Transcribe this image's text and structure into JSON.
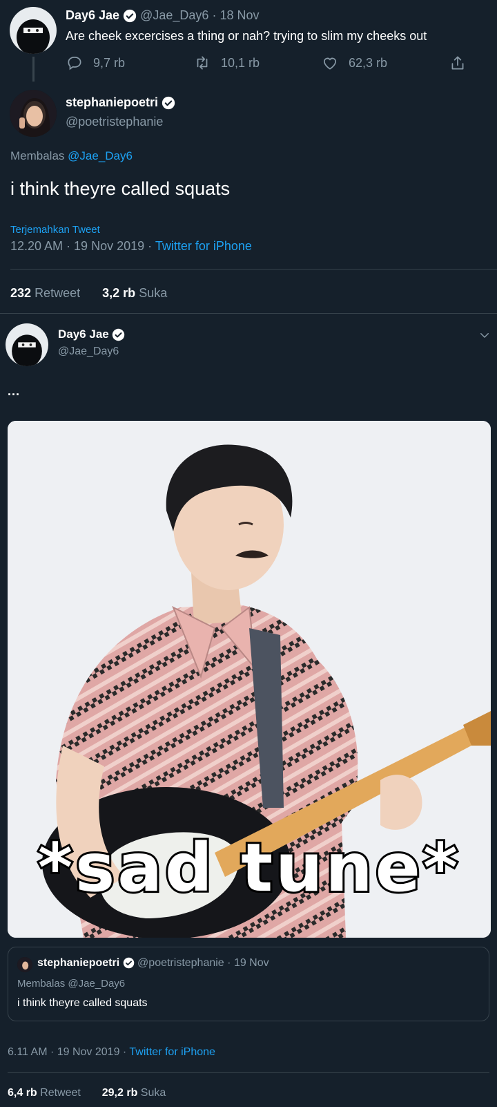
{
  "tweet1": {
    "name": "Day6 Jae",
    "handle": "@Jae_Day6",
    "sep": "·",
    "date": "18 Nov",
    "text": "Are cheek excercises a thing or nah? trying to slim my cheeks out",
    "replies": "9,7 rb",
    "retweets": "10,1 rb",
    "likes": "62,3 rb"
  },
  "reply": {
    "name": "stephaniepoetri",
    "handle": "@poetristephanie",
    "replying_prefix": "Membalas",
    "replying_handle": "@Jae_Day6",
    "text": "i think theyre called squats",
    "translate": "Terjemahkan Tweet",
    "time": "12.20 AM · 19 Nov 2019 ·",
    "source": "Twitter for iPhone",
    "retweet_count": "232",
    "retweet_label": "Retweet",
    "like_count": "3,2 rb",
    "like_label": "Suka"
  },
  "tweet2": {
    "name": "Day6 Jae",
    "handle": "@Jae_Day6",
    "text": "...",
    "image_caption": "*sad tune*",
    "quoted": {
      "name": "stephaniepoetri",
      "handle": "@poetristephanie",
      "sep": "·",
      "date": "19 Nov",
      "replying_prefix": "Membalas",
      "replying_handle": "@Jae_Day6",
      "text": "i think theyre called squats"
    },
    "time": "6.11 AM · 19 Nov 2019 ·",
    "source": "Twitter for iPhone",
    "retweet_count": "6,4 rb",
    "retweet_label": "Retweet",
    "like_count": "29,2 rb",
    "like_label": "Suka"
  },
  "colors": {
    "background": "#15202b",
    "accent": "#1da1f2",
    "muted": "#8899a6",
    "divider": "#38444d"
  }
}
